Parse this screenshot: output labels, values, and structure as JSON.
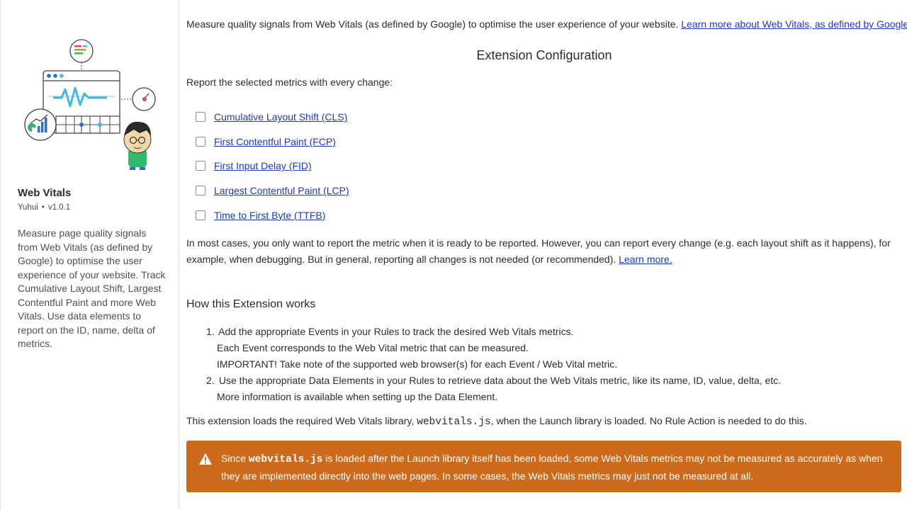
{
  "sidebar": {
    "extension_name": "Web Vitals",
    "author": "Yuhui",
    "separator": "•",
    "version": "v1.0.1",
    "description": "Measure page quality signals from Web Vitals (as defined by Google) to optimise the user experience of your website. Track Cumulative Layout Shift, Largest Contentful Paint and more Web Vitals. Use data elements to report on the ID, name, delta of metrics."
  },
  "main": {
    "intro_text": "Measure quality signals from Web Vitals (as defined by Google) to optimise the user experience of your website.",
    "intro_link": "Learn more about Web Vitals, as defined by Google.",
    "config_title": "Extension Configuration",
    "report_label": "Report the selected metrics with every change:",
    "metrics": [
      {
        "label": "Cumulative Layout Shift (CLS)",
        "checked": false
      },
      {
        "label": "First Contentful Paint (FCP)",
        "checked": false
      },
      {
        "label": "First Input Delay (FID)",
        "checked": false
      },
      {
        "label": "Largest Contentful Paint (LCP)",
        "checked": false
      },
      {
        "label": "Time to First Byte (TTFB)",
        "checked": false
      }
    ],
    "note_text": "In most cases, you only want to report the metric when it is ready to be reported. However, you can report every change (e.g. each layout shift as it happens), for example, when debugging. But in general, reporting all changes is not needed (or recommended).",
    "note_link": "Learn more.",
    "how_title": "How this Extension works",
    "steps": [
      {
        "number": "1.",
        "text": "Add the appropriate Events in your Rules to track the desired Web Vitals metrics.",
        "sub": [
          "Each Event corresponds to the Web Vital metric that can be measured.",
          "IMPORTANT! Take note of the supported web browser(s) for each Event / Web Vital metric."
        ]
      },
      {
        "number": "2.",
        "text": "Use the appropriate Data Elements in your Rules to retrieve data about the Web Vitals metric, like its name, ID, value, delta, etc.",
        "sub": [
          "More information is available when setting up the Data Element."
        ]
      }
    ],
    "loads_before": "This extension loads the required Web Vitals library,",
    "loads_code": "webvitals.js",
    "loads_after": ", when the Launch library is loaded. No Rule Action is needed to do this.",
    "warning_before": "Since",
    "warning_code": "webvitals.js",
    "warning_after": "is loaded after the Launch library itself has been loaded, some Web Vitals metrics may not be measured as accurately as when they are implemented directly into the web pages. In some cases, the Web Vitals metrics may just not be measured at all.",
    "warning_icon": "alert-triangle-icon"
  },
  "colors": {
    "link": "#1f37c9",
    "warning_bg": "#cd6a1c",
    "accent_blue": "#2d6bd6",
    "accent_cyan": "#3fb9e8",
    "accent_red": "#e34850"
  }
}
